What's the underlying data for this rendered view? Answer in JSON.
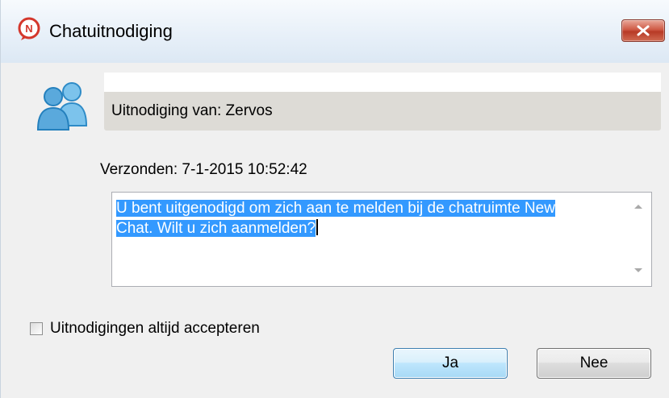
{
  "window": {
    "title": "Chatuitnodiging",
    "icon": "chat-invite-icon",
    "close_icon": "close-icon"
  },
  "header": {
    "icon": "users-icon",
    "from_label": "Uitnodiging van: Zervos"
  },
  "sent": {
    "label": "Verzonden: 7-1-2015 10:52:42"
  },
  "message": {
    "line1": "U bent uitgenodigd om zich aan te melden bij de chatruimte New",
    "line2": "Chat. Wilt u zich aanmelden?"
  },
  "options": {
    "always_accept_label": "Uitnodigingen altijd accepteren",
    "always_accept_checked": false
  },
  "buttons": {
    "yes_label": "Ja",
    "no_label": "Nee"
  },
  "colors": {
    "selection": "#3399ff",
    "close_button": "#c9462f",
    "user_icon": "#5aa9dc"
  }
}
